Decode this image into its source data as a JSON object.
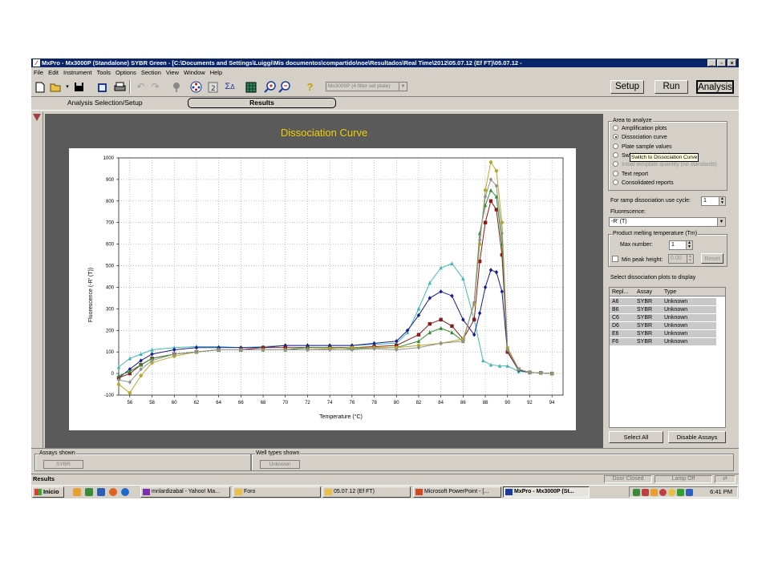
{
  "window": {
    "title": "MxPro - Mx3000P (Standalone) SYBR Green - [C:\\Documents and Settings\\Luiggi\\Mis documentos\\compartido\\noe\\Resultados\\Real Time\\2012\\05.07.12 (Ef FT)\\05.07.12 -",
    "minimize": "_",
    "restore": "▫",
    "close": "×"
  },
  "menu": [
    "File",
    "Edit",
    "Instrument",
    "Tools",
    "Options",
    "Section",
    "View",
    "Window",
    "Help"
  ],
  "toolbar": {
    "plate_type": "Mx3000P (4 filter set plate)",
    "mode_buttons": [
      "Setup",
      "Run",
      "Analysis"
    ],
    "active_mode": "Analysis"
  },
  "tabs": {
    "setup": "Analysis Selection/Setup",
    "results": "Results"
  },
  "right_panel": {
    "area_label": "Area to analyze",
    "options": [
      {
        "label": "Amplification plots",
        "selected": false,
        "disabled": false
      },
      {
        "label": "Dissociation curve",
        "selected": true,
        "disabled": false
      },
      {
        "label": "Plate sample values",
        "selected": false,
        "disabled": false
      },
      {
        "label": "Switch to Dissociation Curve",
        "selected": false,
        "disabled": false
      },
      {
        "label": "Initial template quantity (no standards)",
        "selected": false,
        "disabled": true
      },
      {
        "label": "Text report",
        "selected": false,
        "disabled": false
      },
      {
        "label": "Consolidated reports",
        "selected": false,
        "disabled": false
      }
    ],
    "tooltip": "Switch to Dissociation Curve",
    "ramp_cycle_label": "For ramp dissociation use cycle:",
    "ramp_cycle_value": "1",
    "fluorescence_label": "Fluorescence:",
    "fluorescence_value": "-R' (T)",
    "tm_group_label": "Product melting temperature (Tm)",
    "max_number_label": "Max number:",
    "max_number_value": "1",
    "min_peak_label": "Min peak height:",
    "min_peak_value": "0.00",
    "reset_label": "Reset",
    "select_plots_label": "Select dissociation plots to display",
    "columns": [
      "Repl...",
      "Assay",
      "Type"
    ],
    "wells": [
      {
        "repl": "A6",
        "assay": "SYBR",
        "type": "Unknown"
      },
      {
        "repl": "B6",
        "assay": "SYBR",
        "type": "Unknown"
      },
      {
        "repl": "C6",
        "assay": "SYBR",
        "type": "Unknown"
      },
      {
        "repl": "D6",
        "assay": "SYBR",
        "type": "Unknown"
      },
      {
        "repl": "E6",
        "assay": "SYBR",
        "type": "Unknown"
      },
      {
        "repl": "F6",
        "assay": "SYBR",
        "type": "Unknown"
      }
    ],
    "select_all": "Select All",
    "disable_assays": "Disable Assays"
  },
  "bottom": {
    "assays_label": "Assays shown",
    "assays_tag": "SYBR",
    "wells_label": "Well types shown",
    "wells_tag": "Unknown"
  },
  "status": {
    "text": "Results",
    "door": "Door Closed",
    "lamp": "Lamp Off"
  },
  "taskbar": {
    "start": "Inicio",
    "tasks": [
      {
        "label": "mnlardizabal - Yahoo! Ma...",
        "active": false,
        "color": "#7b2fa8"
      },
      {
        "label": "Foro",
        "active": false,
        "color": "#e8c04a"
      },
      {
        "label": "05.07.12 (Ef FT)",
        "active": false,
        "color": "#e8c04a"
      },
      {
        "label": "Microsoft PowerPoint - [...",
        "active": false,
        "color": "#d24726"
      },
      {
        "label": "MxPro - Mx3000P (St...",
        "active": true,
        "color": "#1c3a9c"
      }
    ],
    "clock": "6:41 PM"
  },
  "chart_data": {
    "type": "line",
    "title": "Dissociation Curve",
    "xlabel": "Temperature (°C)",
    "ylabel": "Fluorescence (-R' (T))",
    "xlim": [
      55,
      95
    ],
    "ylim": [
      -100,
      1000
    ],
    "xticks": [
      56,
      58,
      60,
      62,
      64,
      66,
      68,
      70,
      72,
      74,
      76,
      78,
      80,
      82,
      84,
      86,
      88,
      90,
      92,
      94
    ],
    "yticks": [
      -100,
      0,
      100,
      200,
      300,
      400,
      500,
      600,
      700,
      800,
      900,
      1000
    ],
    "grid": true,
    "series": [
      {
        "color": "#40b8b8",
        "marker": "triangle",
        "points": [
          [
            55,
            30
          ],
          [
            56,
            70
          ],
          [
            57,
            90
          ],
          [
            58,
            110
          ],
          [
            60,
            120
          ],
          [
            62,
            125
          ],
          [
            64,
            125
          ],
          [
            66,
            120
          ],
          [
            68,
            125
          ],
          [
            70,
            130
          ],
          [
            72,
            130
          ],
          [
            74,
            130
          ],
          [
            76,
            130
          ],
          [
            78,
            135
          ],
          [
            80,
            140
          ],
          [
            81,
            190
          ],
          [
            82,
            300
          ],
          [
            83,
            420
          ],
          [
            84,
            490
          ],
          [
            85,
            510
          ],
          [
            86,
            440
          ],
          [
            87,
            250
          ],
          [
            87.8,
            60
          ],
          [
            88.5,
            40
          ],
          [
            89.3,
            35
          ],
          [
            90,
            35
          ],
          [
            91,
            10
          ],
          [
            92,
            5
          ],
          [
            93,
            3
          ],
          [
            94,
            0
          ]
        ]
      },
      {
        "color": "#1a1a90",
        "marker": "diamond",
        "points": [
          [
            55,
            -20
          ],
          [
            56,
            20
          ],
          [
            57,
            60
          ],
          [
            58,
            90
          ],
          [
            60,
            110
          ],
          [
            62,
            120
          ],
          [
            64,
            120
          ],
          [
            66,
            120
          ],
          [
            68,
            120
          ],
          [
            70,
            130
          ],
          [
            72,
            130
          ],
          [
            74,
            130
          ],
          [
            76,
            130
          ],
          [
            78,
            140
          ],
          [
            80,
            150
          ],
          [
            81,
            200
          ],
          [
            82,
            270
          ],
          [
            83,
            350
          ],
          [
            84,
            380
          ],
          [
            85,
            360
          ],
          [
            86,
            250
          ],
          [
            87,
            180
          ],
          [
            87.5,
            280
          ],
          [
            88,
            400
          ],
          [
            88.5,
            480
          ],
          [
            89,
            470
          ],
          [
            89.5,
            380
          ],
          [
            90,
            100
          ],
          [
            91,
            15
          ],
          [
            92,
            5
          ],
          [
            93,
            3
          ],
          [
            94,
            0
          ]
        ]
      },
      {
        "color": "#8b1a1a",
        "marker": "square",
        "points": [
          [
            55,
            -20
          ],
          [
            56,
            0
          ],
          [
            57,
            40
          ],
          [
            58,
            70
          ],
          [
            60,
            90
          ],
          [
            62,
            100
          ],
          [
            64,
            110
          ],
          [
            66,
            110
          ],
          [
            68,
            120
          ],
          [
            70,
            120
          ],
          [
            72,
            120
          ],
          [
            74,
            120
          ],
          [
            76,
            120
          ],
          [
            78,
            125
          ],
          [
            80,
            130
          ],
          [
            82,
            180
          ],
          [
            83,
            230
          ],
          [
            84,
            250
          ],
          [
            85,
            220
          ],
          [
            86,
            160
          ],
          [
            87,
            250
          ],
          [
            87.5,
            520
          ],
          [
            88,
            700
          ],
          [
            88.5,
            800
          ],
          [
            89,
            760
          ],
          [
            89.5,
            550
          ],
          [
            90,
            100
          ],
          [
            91,
            20
          ],
          [
            92,
            5
          ],
          [
            93,
            3
          ],
          [
            94,
            0
          ]
        ]
      },
      {
        "color": "#2e8b2e",
        "marker": "triangle",
        "points": [
          [
            55,
            -10
          ],
          [
            56,
            10
          ],
          [
            57,
            40
          ],
          [
            58,
            70
          ],
          [
            60,
            90
          ],
          [
            62,
            100
          ],
          [
            64,
            110
          ],
          [
            66,
            110
          ],
          [
            68,
            110
          ],
          [
            70,
            110
          ],
          [
            72,
            120
          ],
          [
            74,
            120
          ],
          [
            76,
            115
          ],
          [
            78,
            120
          ],
          [
            80,
            120
          ],
          [
            82,
            150
          ],
          [
            83,
            190
          ],
          [
            84,
            210
          ],
          [
            85,
            190
          ],
          [
            86,
            150
          ],
          [
            87,
            330
          ],
          [
            87.5,
            650
          ],
          [
            88,
            780
          ],
          [
            88.5,
            850
          ],
          [
            89,
            820
          ],
          [
            89.5,
            600
          ],
          [
            90,
            120
          ],
          [
            91,
            20
          ],
          [
            92,
            5
          ],
          [
            93,
            3
          ],
          [
            94,
            0
          ]
        ]
      },
      {
        "color": "#b8a828",
        "marker": "circle",
        "points": [
          [
            55,
            -50
          ],
          [
            56,
            -90
          ],
          [
            57,
            -10
          ],
          [
            58,
            50
          ],
          [
            60,
            80
          ],
          [
            62,
            100
          ],
          [
            64,
            110
          ],
          [
            66,
            110
          ],
          [
            68,
            110
          ],
          [
            70,
            110
          ],
          [
            72,
            110
          ],
          [
            74,
            115
          ],
          [
            76,
            120
          ],
          [
            78,
            120
          ],
          [
            80,
            120
          ],
          [
            82,
            130
          ],
          [
            84,
            140
          ],
          [
            86,
            160
          ],
          [
            87,
            320
          ],
          [
            87.5,
            600
          ],
          [
            88,
            850
          ],
          [
            88.5,
            980
          ],
          [
            89,
            940
          ],
          [
            89.5,
            700
          ],
          [
            90,
            120
          ],
          [
            91,
            20
          ],
          [
            92,
            5
          ],
          [
            93,
            3
          ],
          [
            94,
            0
          ]
        ]
      },
      {
        "color": "#909090",
        "marker": "diamond",
        "points": [
          [
            55,
            -30
          ],
          [
            56,
            -40
          ],
          [
            57,
            20
          ],
          [
            58,
            60
          ],
          [
            60,
            90
          ],
          [
            62,
            100
          ],
          [
            64,
            110
          ],
          [
            66,
            110
          ],
          [
            68,
            110
          ],
          [
            70,
            110
          ],
          [
            72,
            110
          ],
          [
            74,
            110
          ],
          [
            76,
            110
          ],
          [
            78,
            115
          ],
          [
            80,
            110
          ],
          [
            82,
            120
          ],
          [
            84,
            140
          ],
          [
            86,
            150
          ],
          [
            87,
            330
          ],
          [
            87.5,
            620
          ],
          [
            88,
            820
          ],
          [
            88.5,
            900
          ],
          [
            89,
            870
          ],
          [
            89.5,
            650
          ],
          [
            90,
            110
          ],
          [
            91,
            20
          ],
          [
            92,
            5
          ],
          [
            93,
            3
          ],
          [
            94,
            0
          ]
        ]
      }
    ]
  }
}
